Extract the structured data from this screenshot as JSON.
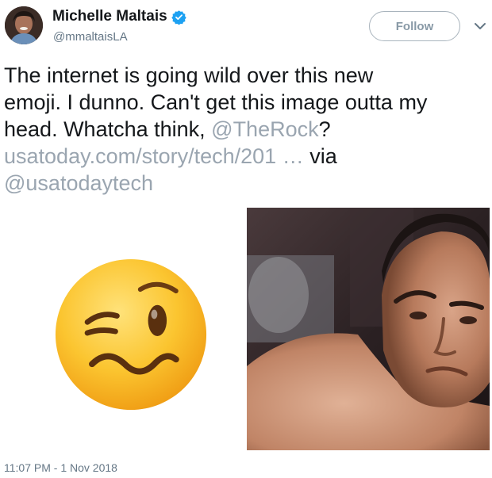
{
  "author": {
    "display_name": "Michelle Maltais",
    "handle": "@mmaltaisLA",
    "verified": true,
    "avatar_icon": "user-avatar"
  },
  "actions": {
    "follow_label": "Follow",
    "more_icon": "chevron-down-icon"
  },
  "tweet": {
    "line1": "The internet is going wild over this new",
    "line2": "emoji. I dunno. Can't get this image outta my",
    "line3_prefix": "head. Whatcha think, ",
    "mention": "@TheRock",
    "line3_suffix": "?",
    "url": "usatoday.com/story/tech/201",
    "url_ellipsis": " … ",
    "via": "via",
    "via_mention": "@usatodaytech"
  },
  "media": {
    "image1": "woozy-face-emoji",
    "image2": "the-rock-raised-eyebrow-photo"
  },
  "timestamp": "11:07 PM - 1 Nov 2018",
  "colors": {
    "text": "#14171a",
    "secondary": "#657786",
    "link": "#9aa5b0",
    "verified": "#1da1f2",
    "emoji_yellow": "#f9c22e"
  }
}
